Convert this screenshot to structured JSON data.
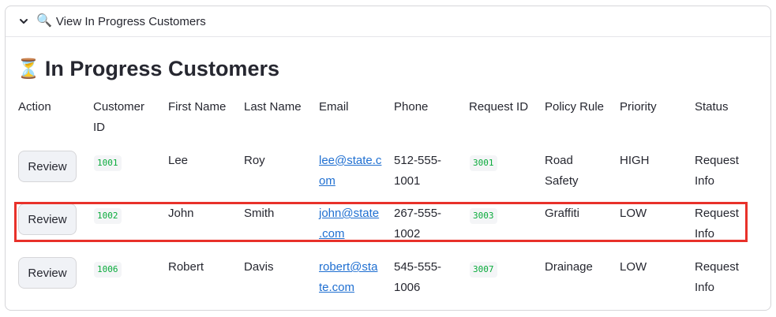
{
  "expander": {
    "title": "View In Progress Customers",
    "chevron_icon": "chevron-down-icon",
    "search_icon": "🔍"
  },
  "section": {
    "icon": "⏳",
    "title": "In Progress Customers"
  },
  "table": {
    "columns": {
      "action": "Action",
      "customer_id_1": "Customer",
      "customer_id_2": "ID",
      "first_name": "First Name",
      "last_name": "Last Name",
      "email": "Email",
      "phone": "Phone",
      "request_id": "Request ID",
      "policy_rule": "Policy Rule",
      "priority": "Priority",
      "status": "Status"
    },
    "rows": [
      {
        "action": "Review",
        "customer_id": "1001",
        "first_name": "Lee",
        "last_name": "Roy",
        "email_1": "lee@state.c",
        "email_2": "om",
        "phone_1": "512-555-",
        "phone_2": "1001",
        "request_id": "3001",
        "policy_1": "Road",
        "policy_2": "Safety",
        "priority": "HIGH",
        "status_1": "Request",
        "status_2": "Info"
      },
      {
        "action": "Review",
        "customer_id": "1002",
        "first_name": "John",
        "last_name": "Smith",
        "email_1": "john@state",
        "email_2": ".com",
        "phone_1": "267-555-",
        "phone_2": "1002",
        "request_id": "3003",
        "policy_1": "Graffiti",
        "policy_2": "",
        "priority": "LOW",
        "status_1": "Request",
        "status_2": "Info"
      },
      {
        "action": "Review",
        "customer_id": "1006",
        "first_name": "Robert",
        "last_name": "Davis",
        "email_1": "robert@sta",
        "email_2": "te.com",
        "phone_1": "545-555-",
        "phone_2": "1006",
        "request_id": "3007",
        "policy_1": "Drainage",
        "policy_2": "",
        "priority": "LOW",
        "status_1": "Request",
        "status_2": "Info"
      }
    ]
  },
  "colors": {
    "highlight": "#e8312a",
    "link": "#1f6fd1",
    "code_text": "#09ab3b"
  }
}
